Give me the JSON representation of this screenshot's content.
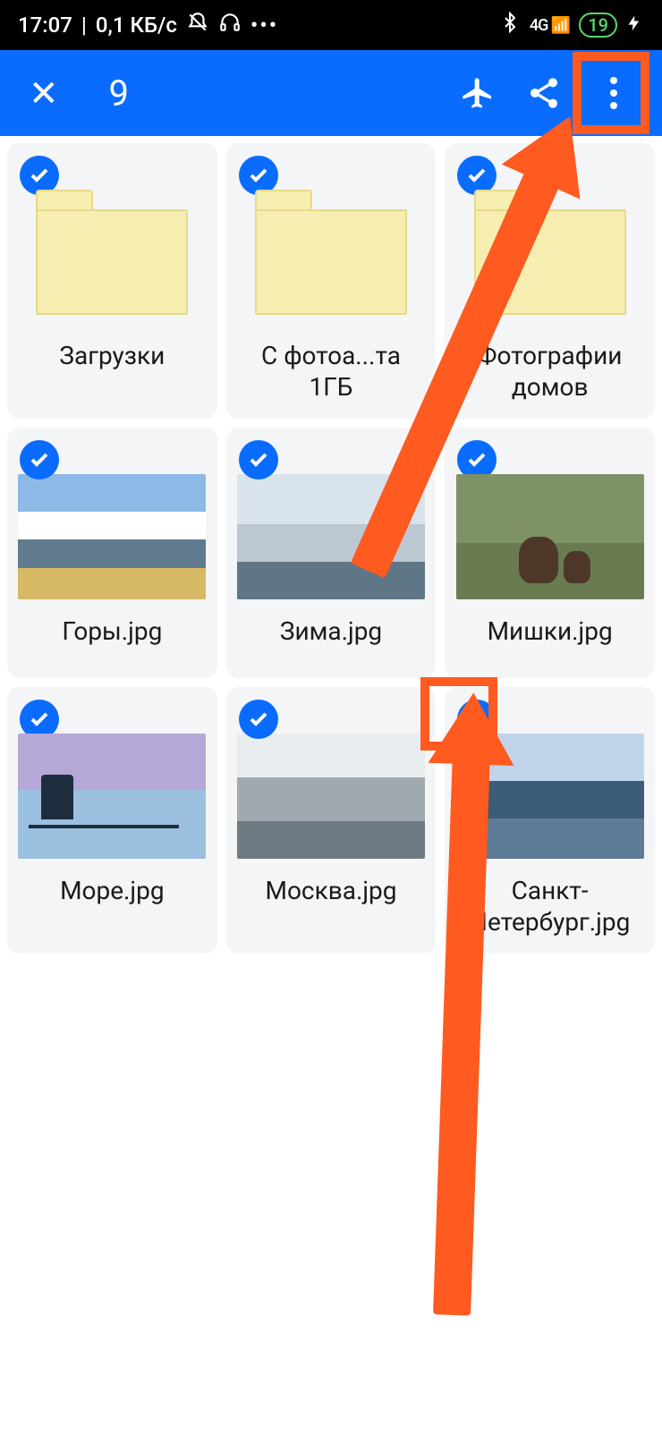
{
  "status": {
    "time": "17:07",
    "net_speed": "0,1 КБ/с",
    "battery_pct": "19",
    "network_label": "4G"
  },
  "appbar": {
    "selected_count": "9"
  },
  "items": [
    {
      "name": "Загрузки",
      "kind": "folder"
    },
    {
      "name": "С фотоа...та 1ГБ",
      "kind": "folder"
    },
    {
      "name": "Фотографии домов",
      "kind": "folder"
    },
    {
      "name": "Горы.jpg",
      "kind": "image",
      "img": "mountain"
    },
    {
      "name": "Зима.jpg",
      "kind": "image",
      "img": "winter"
    },
    {
      "name": "Мишки.jpg",
      "kind": "image",
      "img": "bears"
    },
    {
      "name": "Море.jpg",
      "kind": "image",
      "img": "sea"
    },
    {
      "name": "Москва.jpg",
      "kind": "image",
      "img": "moscow"
    },
    {
      "name": "Санкт-Петербург.jpg",
      "kind": "image",
      "img": "spb"
    }
  ]
}
